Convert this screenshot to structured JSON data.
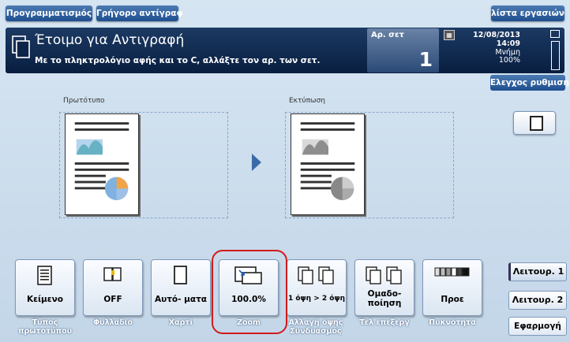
{
  "topbar": {
    "tab_programs": "Προγραμματισμός",
    "tab_quick_copy": "Γρήγορο αντίγραφ",
    "job_list": "λίστα εργασιών"
  },
  "status": {
    "title": "Έτοιμο για Αντιγραφή",
    "subtitle": "Με το πληκτρολόγιο αφής και το C, αλλάξτε τον αρ. των σετ.",
    "sets_label": "Αρ. σετ",
    "sets_value": "1",
    "date": "12/08/2013",
    "time": "14:09",
    "memory_label": "Μνήμη",
    "memory_value": "100%"
  },
  "check_settings": "Ελεγχος ρυθμισης",
  "preview": {
    "original_label": "Πρωτότυπο",
    "output_label": "Εκτύπωση"
  },
  "functions": [
    {
      "value": "Κείμενο",
      "label": "Τύπος πρωτοτύπου",
      "icon": "text-document-icon"
    },
    {
      "value": "OFF",
      "label": "Φυλλάδιο",
      "icon": "booklet-icon"
    },
    {
      "value": "Αυτό- ματα",
      "label": "Χαρτί",
      "icon": "paper-icon"
    },
    {
      "value": "100.0%",
      "label": "Zoom",
      "icon": "zoom-icon"
    },
    {
      "value": "1 όψη > 2 όψη",
      "label": "Αλλαγή όψης Συνδυασμός",
      "icon": "duplex-icon"
    },
    {
      "value": "Ομαδο- ποίηση",
      "label": "Τελ επεξεργ",
      "icon": "collate-icon"
    },
    {
      "value": "Προε",
      "label": "Πυκνότητα",
      "icon": "density-icon"
    }
  ],
  "side": {
    "func1": "Λειτουρ. 1",
    "func2": "Λειτουρ. 2",
    "apply": "Εφαρμογή"
  },
  "colors": {
    "status_bg": "#0c2448",
    "accent_blue": "#1f4f8f",
    "highlight_ring": "#d11a1a",
    "panel_bg": "#c9dbec"
  }
}
